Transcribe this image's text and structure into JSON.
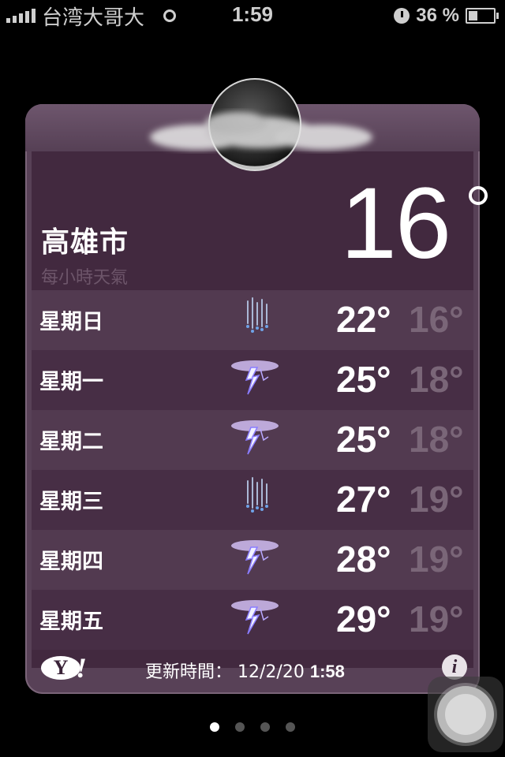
{
  "status_bar": {
    "carrier": "台湾大哥大",
    "time": "1:59",
    "battery": "36 %",
    "battery_level": 0.36,
    "icons": [
      "signal-bars-icon",
      "network-ring-icon",
      "clock-icon",
      "battery-icon"
    ]
  },
  "weather": {
    "city": "高雄市",
    "subtitle": "每小時天氣",
    "current_temp": "16",
    "condition_icon": "moon-cloud-icon",
    "forecast": [
      {
        "day": "星期日",
        "icon": "rain-icon",
        "high": "22°",
        "low": "16°"
      },
      {
        "day": "星期一",
        "icon": "thunderstorm-icon",
        "high": "25°",
        "low": "18°"
      },
      {
        "day": "星期二",
        "icon": "thunderstorm-icon",
        "high": "25°",
        "low": "18°"
      },
      {
        "day": "星期三",
        "icon": "rain-icon",
        "high": "27°",
        "low": "19°"
      },
      {
        "day": "星期四",
        "icon": "thunderstorm-icon",
        "high": "28°",
        "low": "19°"
      },
      {
        "day": "星期五",
        "icon": "thunderstorm-icon",
        "high": "29°",
        "low": "19°"
      }
    ],
    "footer": {
      "yahoo_logo": "Y!",
      "updated_label": "更新時間：",
      "updated_date": "12/2/20",
      "updated_time": "1:58",
      "info_icon": "i"
    }
  },
  "pages": {
    "count": 4,
    "active": 0
  },
  "colors": {
    "card": "#584157",
    "row_light": "#523a50",
    "row_dark": "#472e45",
    "low_temp": "#7a6678"
  }
}
